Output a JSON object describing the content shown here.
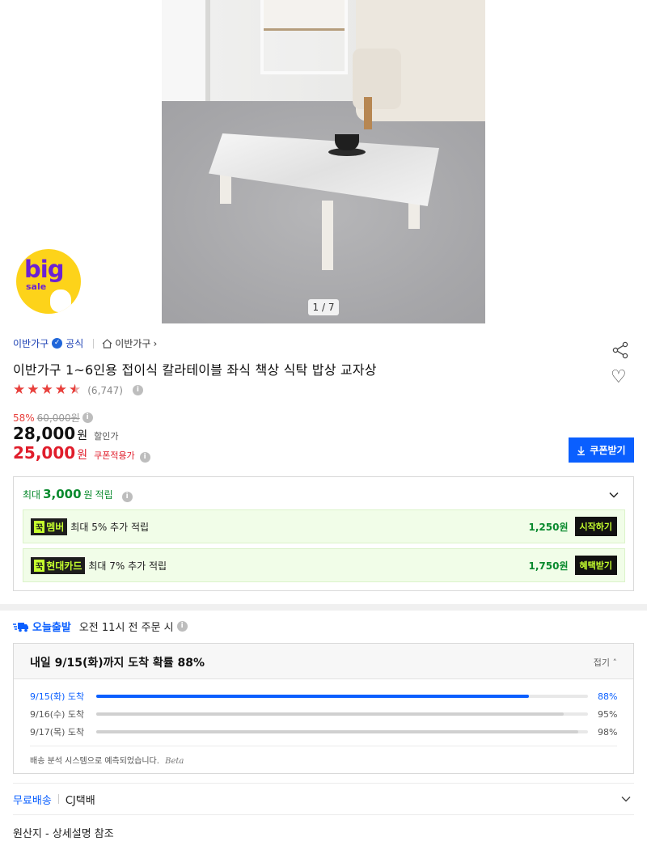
{
  "gallery": {
    "page_indicator": "1 / 7"
  },
  "promo_badge": {
    "big": "big",
    "sale": "sale"
  },
  "seller": {
    "name": "이반가구",
    "official": "공식",
    "store_link": "이반가구"
  },
  "product": {
    "title": "이반가구 1~6인용 접이식 칼라테이블 좌식 책상 식탁 밥상 교자상",
    "rating": 4.5,
    "review_count": "(6,747)"
  },
  "pricing": {
    "discount_pct": "58%",
    "original_price": "60,000원",
    "sale_price": "28,000",
    "sale_unit": "원",
    "sale_label": "할인가",
    "coupon_price": "25,000",
    "coupon_unit": "원",
    "coupon_label": "쿠폰적용가",
    "coupon_button": "쿠폰받기"
  },
  "reward": {
    "prefix": "최대",
    "amount": "3,000",
    "unit": "원",
    "suffix": "적립",
    "items": [
      {
        "tag_k": "꾹",
        "tag": "멤버",
        "desc": "최대 5% 추가 적립",
        "amount": "1,250원",
        "button": "시작하기"
      },
      {
        "tag_k": "꾹",
        "tag": "현대카드",
        "desc": "최대 7% 추가 적립",
        "amount": "1,750원",
        "button": "혜택받기"
      }
    ]
  },
  "shipping": {
    "label": "오늘출발",
    "cutoff": "오전 11시 전 주문 시",
    "headline": "내일 9/15(화)까지 도착 확률 88%",
    "fold": "접기",
    "rows": [
      {
        "date": "9/15(화) 도착",
        "pct_text": "88%",
        "value": 0.88
      },
      {
        "date": "9/16(수) 도착",
        "pct_text": "95%",
        "value": 0.95
      },
      {
        "date": "9/17(목) 도착",
        "pct_text": "98%",
        "value": 0.98
      }
    ],
    "note": "배송 분석 시스템으로 예측되었습니다.",
    "beta": "Beta",
    "free_label": "무료배송",
    "carrier": "CJ택배"
  },
  "origin": "원산지 - 상세설명 참조",
  "colors": {
    "accent_blue": "#0a5fff",
    "price_red": "#e01d2b",
    "reward_green": "#0a8a2e",
    "star_red": "#e8403c"
  }
}
